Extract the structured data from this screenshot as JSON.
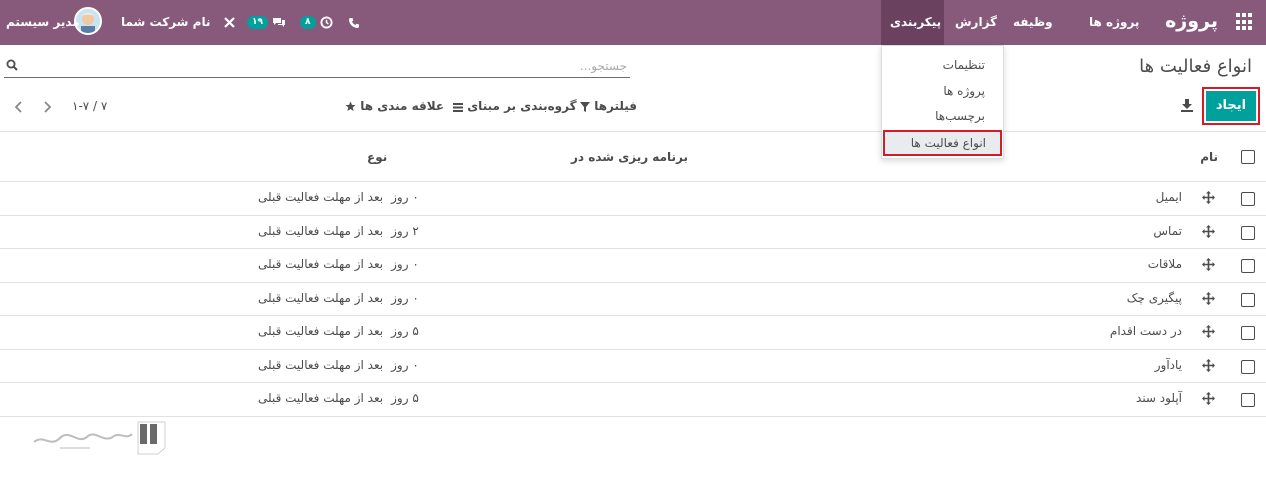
{
  "navbar": {
    "app_name": "پروژه",
    "menus": [
      "پروژه ها",
      "وظیفه",
      "گزارش",
      "پیکربندی"
    ],
    "active_menu": "پیکربندی",
    "activity_count": "۸",
    "messages_count": "۱۹",
    "company": "نام شرکت شما",
    "user": "مدیر سیستم"
  },
  "dropdown": {
    "items": [
      "تنظیمات",
      "پروژه ها",
      "برچسب‌ها",
      "انواع فعالیت ها"
    ],
    "active_item": "انواع فعالیت ها"
  },
  "control_panel": {
    "title": "انواع فعالیت ها",
    "search_placeholder": "جستجو...",
    "create_label": "ایجاد",
    "filters_label": "فیلترها",
    "groupby_label": "گروه‌بندی بر مبنای",
    "favorites_label": "علاقه مندی ها",
    "pager_value": "۱-۷ / ۷"
  },
  "table": {
    "headers": {
      "name": "نام",
      "planned": "برنامه ریزی شده در",
      "type": "نوع"
    },
    "rows": [
      {
        "name": "ایمیل",
        "days": "۰ روز",
        "type": "بعد از مهلت فعالیت قبلی"
      },
      {
        "name": "تماس",
        "days": "۲ روز",
        "type": "بعد از مهلت فعالیت قبلی"
      },
      {
        "name": "ملاقات",
        "days": "۰ روز",
        "type": "بعد از مهلت فعالیت قبلی"
      },
      {
        "name": "پیگیری چک",
        "days": "۰ روز",
        "type": "بعد از مهلت فعالیت قبلی"
      },
      {
        "name": "در دست اقدام",
        "days": "۵ روز",
        "type": "بعد از مهلت فعالیت قبلی"
      },
      {
        "name": "یادآور",
        "days": "۰ روز",
        "type": "بعد از مهلت فعالیت قبلی"
      },
      {
        "name": "آپلود سند",
        "days": "۵ روز",
        "type": "بعد از مهلت فعالیت قبلی"
      }
    ]
  },
  "colors": {
    "navbar": "#875a7b",
    "primary": "#00a09d",
    "highlight": "#d61b27"
  }
}
